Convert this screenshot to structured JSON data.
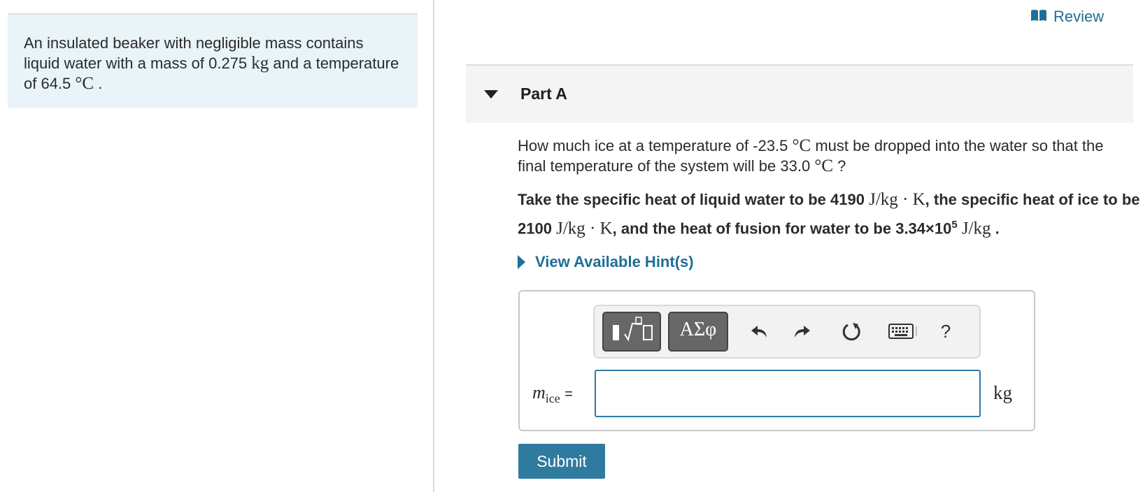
{
  "problem": {
    "intro": "An insulated beaker with negligible mass contains liquid water with a mass of 0.275",
    "mass_unit": "kg",
    "mid": "and a temperature of 64.5",
    "temp_unit": "°C",
    "end": "."
  },
  "review": {
    "label": "Review",
    "icon": "book-icon"
  },
  "part": {
    "title": "Part A"
  },
  "question": {
    "t1": "How much ice at a temperature of -23.5",
    "u1": "°C",
    "t2": "must be dropped into the water so that the final temperature of the system will be 33.0",
    "u2": "°C",
    "t3": "?"
  },
  "constants": {
    "t1": "Take the specific heat of liquid water to be 4190",
    "u1": "J/kg · K",
    "t2": ", the specific heat of ice to be 2100",
    "u2": "J/kg · K",
    "t3": ", and the heat of fusion for water to be 3.34×10",
    "exp": "5",
    "u3": "J/kg",
    "t4": "."
  },
  "hint": {
    "label": "View Available Hint(s)"
  },
  "toolbar": {
    "templates_icon": "templates-icon",
    "greek_label": "ΑΣφ",
    "undo_icon": "undo-icon",
    "redo_icon": "redo-icon",
    "reset_icon": "reset-icon",
    "keyboard_icon": "keyboard-icon",
    "help_label": "?"
  },
  "answer": {
    "variable": "m",
    "subscript": "ice",
    "equals": "=",
    "value": "",
    "unit": "kg"
  },
  "submit": {
    "label": "Submit"
  },
  "colors": {
    "link": "#1f6e94",
    "panel_bg": "#e8f4f7",
    "submit_bg": "#2f7ba0",
    "input_border": "#2f7ba6"
  }
}
